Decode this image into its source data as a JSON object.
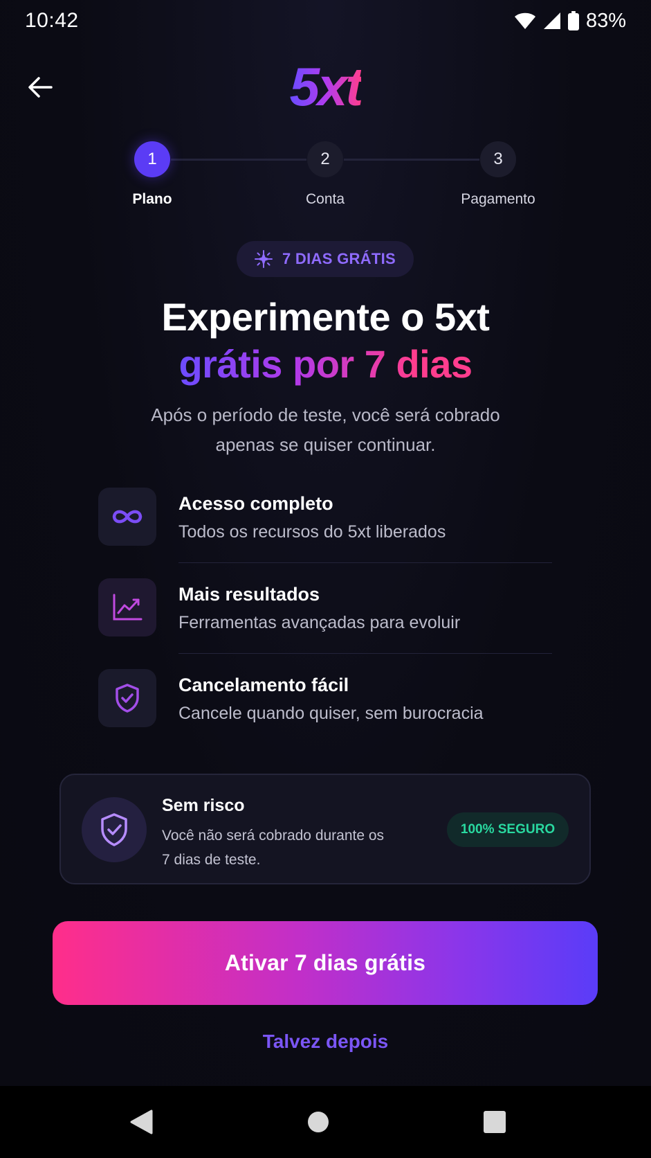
{
  "status_bar": {
    "time": "10:42",
    "battery": "83%"
  },
  "header": {
    "logo": "5xt"
  },
  "stepper": {
    "steps": [
      {
        "number": "1",
        "label": "Plano",
        "active": true
      },
      {
        "number": "2",
        "label": "Conta",
        "active": false
      },
      {
        "number": "3",
        "label": "Pagamento",
        "active": false
      }
    ]
  },
  "badge": {
    "label": "7 DIAS GRÁTIS",
    "icon": "sparkle-icon"
  },
  "headline": {
    "line1": "Experimente o 5xt",
    "line2": "grátis por 7 dias"
  },
  "subtitle": {
    "line1": "Após o período de teste, você será cobrado",
    "line2": "apenas se quiser continuar."
  },
  "features": [
    {
      "icon": "infinity-icon",
      "title": "Acesso completo",
      "desc": "Todos os recursos do 5xt liberados"
    },
    {
      "icon": "trending-up-icon",
      "title": "Mais resultados",
      "desc": "Ferramentas avançadas para evoluir"
    },
    {
      "icon": "shield-check-icon",
      "title": "Cancelamento fácil",
      "desc": "Cancele quando quiser, sem burocracia"
    }
  ],
  "risk_card": {
    "title": "Sem risco",
    "desc_line1": "Você não será cobrado durante os",
    "desc_line2": "7 dias de teste.",
    "badge": "100% SEGURO"
  },
  "cta": {
    "label": "Ativar 7 dias grátis"
  },
  "secondary": {
    "label": "Talvez depois"
  },
  "colors": {
    "accent_purple": "#5b3cf5",
    "accent_pink": "#ff2e8a",
    "secure_green": "#29d9a0",
    "background": "#0b0b14"
  }
}
